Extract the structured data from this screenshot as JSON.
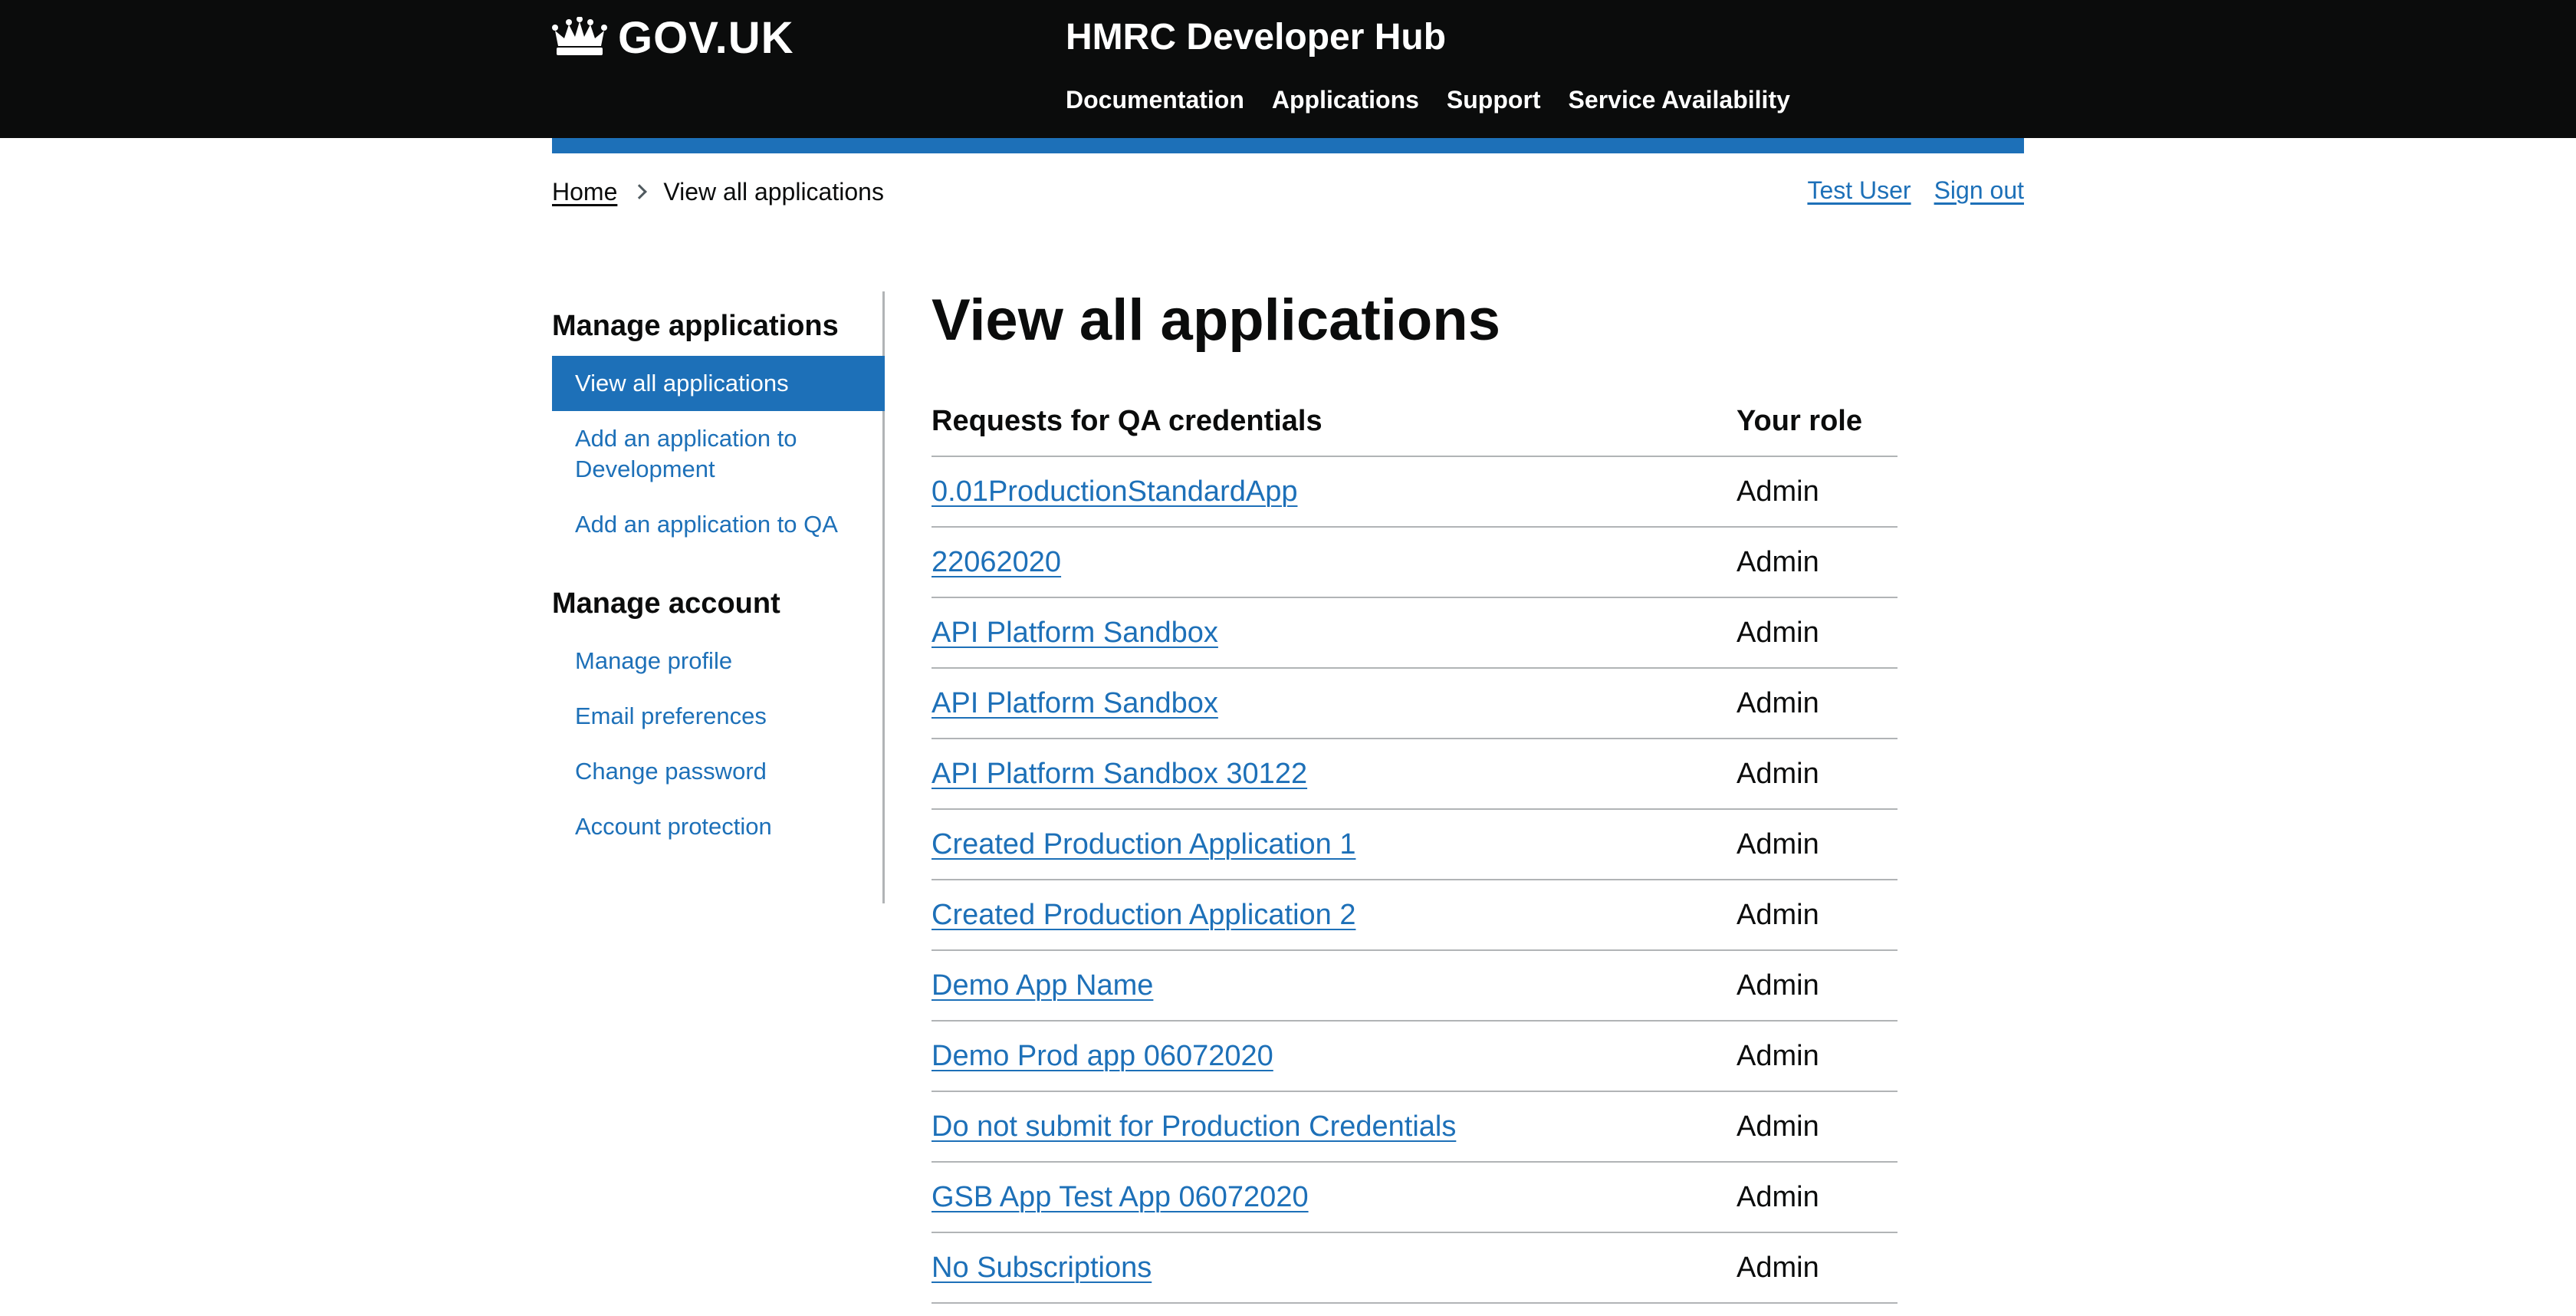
{
  "header": {
    "logo_text": "GOV.UK",
    "service_name": "HMRC Developer Hub",
    "nav": [
      "Documentation",
      "Applications",
      "Support",
      "Service Availability"
    ]
  },
  "breadcrumb": {
    "home": "Home",
    "current": "View all applications"
  },
  "user_links": {
    "user": "Test User",
    "sign_out": "Sign out"
  },
  "sidebar": {
    "manage_applications_heading": "Manage applications",
    "app_items": [
      "View all applications",
      "Add an application to Development",
      "Add an application to QA"
    ],
    "active_index": 0,
    "manage_account_heading": "Manage account",
    "account_items": [
      "Manage profile",
      "Email preferences",
      "Change password",
      "Account protection"
    ]
  },
  "main": {
    "title": "View all applications",
    "table": {
      "headers": [
        "Requests for QA credentials",
        "Your role"
      ],
      "rows": [
        {
          "name": "0.01ProductionStandardApp",
          "role": "Admin"
        },
        {
          "name": "22062020",
          "role": "Admin"
        },
        {
          "name": "API Platform Sandbox",
          "role": "Admin"
        },
        {
          "name": "API Platform Sandbox",
          "role": "Admin"
        },
        {
          "name": "API Platform Sandbox 30122",
          "role": "Admin"
        },
        {
          "name": "Created Production Application 1",
          "role": "Admin"
        },
        {
          "name": "Created Production Application 2",
          "role": "Admin"
        },
        {
          "name": "Demo App Name",
          "role": "Admin"
        },
        {
          "name": "Demo Prod app 06072020",
          "role": "Admin"
        },
        {
          "name": "Do not submit for Production Credentials",
          "role": "Admin"
        },
        {
          "name": "GSB App Test App 06072020",
          "role": "Admin"
        },
        {
          "name": "No Subscriptions",
          "role": "Admin"
        }
      ]
    }
  },
  "colors": {
    "header_bg": "#0b0c0c",
    "brand_blue": "#1d70b8",
    "text": "#0b0c0c",
    "divider": "#b1b4b6"
  }
}
